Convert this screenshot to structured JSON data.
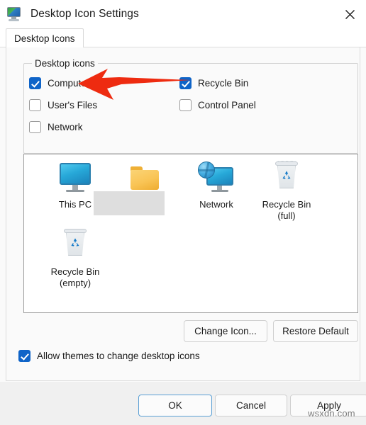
{
  "window": {
    "title": "Desktop Icon Settings",
    "icon": "desktop-monitor-icon",
    "close_label": "✕"
  },
  "tabs": [
    {
      "label": "Desktop Icons",
      "selected": true
    }
  ],
  "group": {
    "title": "Desktop icons",
    "checkboxes": [
      {
        "label": "Computer",
        "checked": true,
        "col": 0,
        "row": 0
      },
      {
        "label": "Recycle Bin",
        "checked": true,
        "col": 1,
        "row": 0
      },
      {
        "label": "User's Files",
        "checked": false,
        "col": 0,
        "row": 1
      },
      {
        "label": "Control Panel",
        "checked": false,
        "col": 1,
        "row": 1
      },
      {
        "label": "Network",
        "checked": false,
        "col": 0,
        "row": 2
      }
    ]
  },
  "preview": {
    "items": [
      {
        "icon": "this-pc-icon",
        "label": "This PC",
        "label2": ""
      },
      {
        "icon": "folder-icon",
        "label": "",
        "label2": "",
        "redacted": true
      },
      {
        "icon": "network-icon",
        "label": "Network",
        "label2": ""
      },
      {
        "icon": "recycle-bin-full-icon",
        "label": "Recycle Bin",
        "label2": "(full)"
      },
      {
        "icon": "recycle-bin-empty-icon",
        "label": "Recycle Bin",
        "label2": "(empty)"
      }
    ]
  },
  "actions": {
    "change_icon": "Change Icon...",
    "restore_default": "Restore Default"
  },
  "allow_themes": {
    "label": "Allow themes to change desktop icons",
    "checked": true
  },
  "footer": {
    "ok": "OK",
    "cancel": "Cancel",
    "apply": "Apply"
  },
  "annotation": {
    "arrow_color": "#ee2b10",
    "target": "Computer"
  },
  "watermark": "wsxdn.com",
  "colors": {
    "accent": "#0f64c8",
    "focus_border": "#5a9fd4",
    "arrow_red": "#ee2b10",
    "redaction_gray": "#dedede"
  }
}
